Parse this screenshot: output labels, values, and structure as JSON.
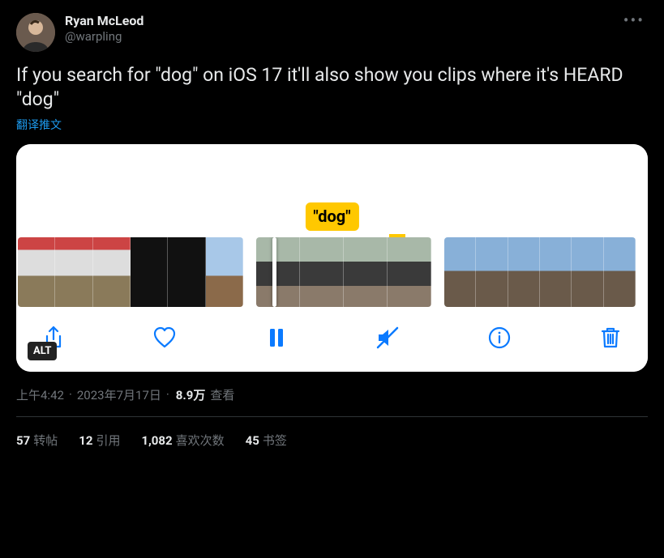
{
  "author": {
    "display_name": "Ryan McLeod",
    "handle": "@warpling"
  },
  "tweet_text": "If you search for \"dog\" on iOS 17 it'll also show you clips where it's HEARD \"dog\"",
  "translate_label": "翻译推文",
  "media": {
    "tooltip_label": "\"dog\"",
    "alt_badge": "ALT"
  },
  "meta": {
    "time": "上午4:42",
    "date": "2023年7月17日",
    "views_number": "8.9万",
    "views_label": "查看"
  },
  "stats": {
    "retweets": {
      "count": "57",
      "label": "转帖"
    },
    "quotes": {
      "count": "12",
      "label": "引用"
    },
    "likes": {
      "count": "1,082",
      "label": "喜欢次数"
    },
    "bookmarks": {
      "count": "45",
      "label": "书签"
    }
  }
}
